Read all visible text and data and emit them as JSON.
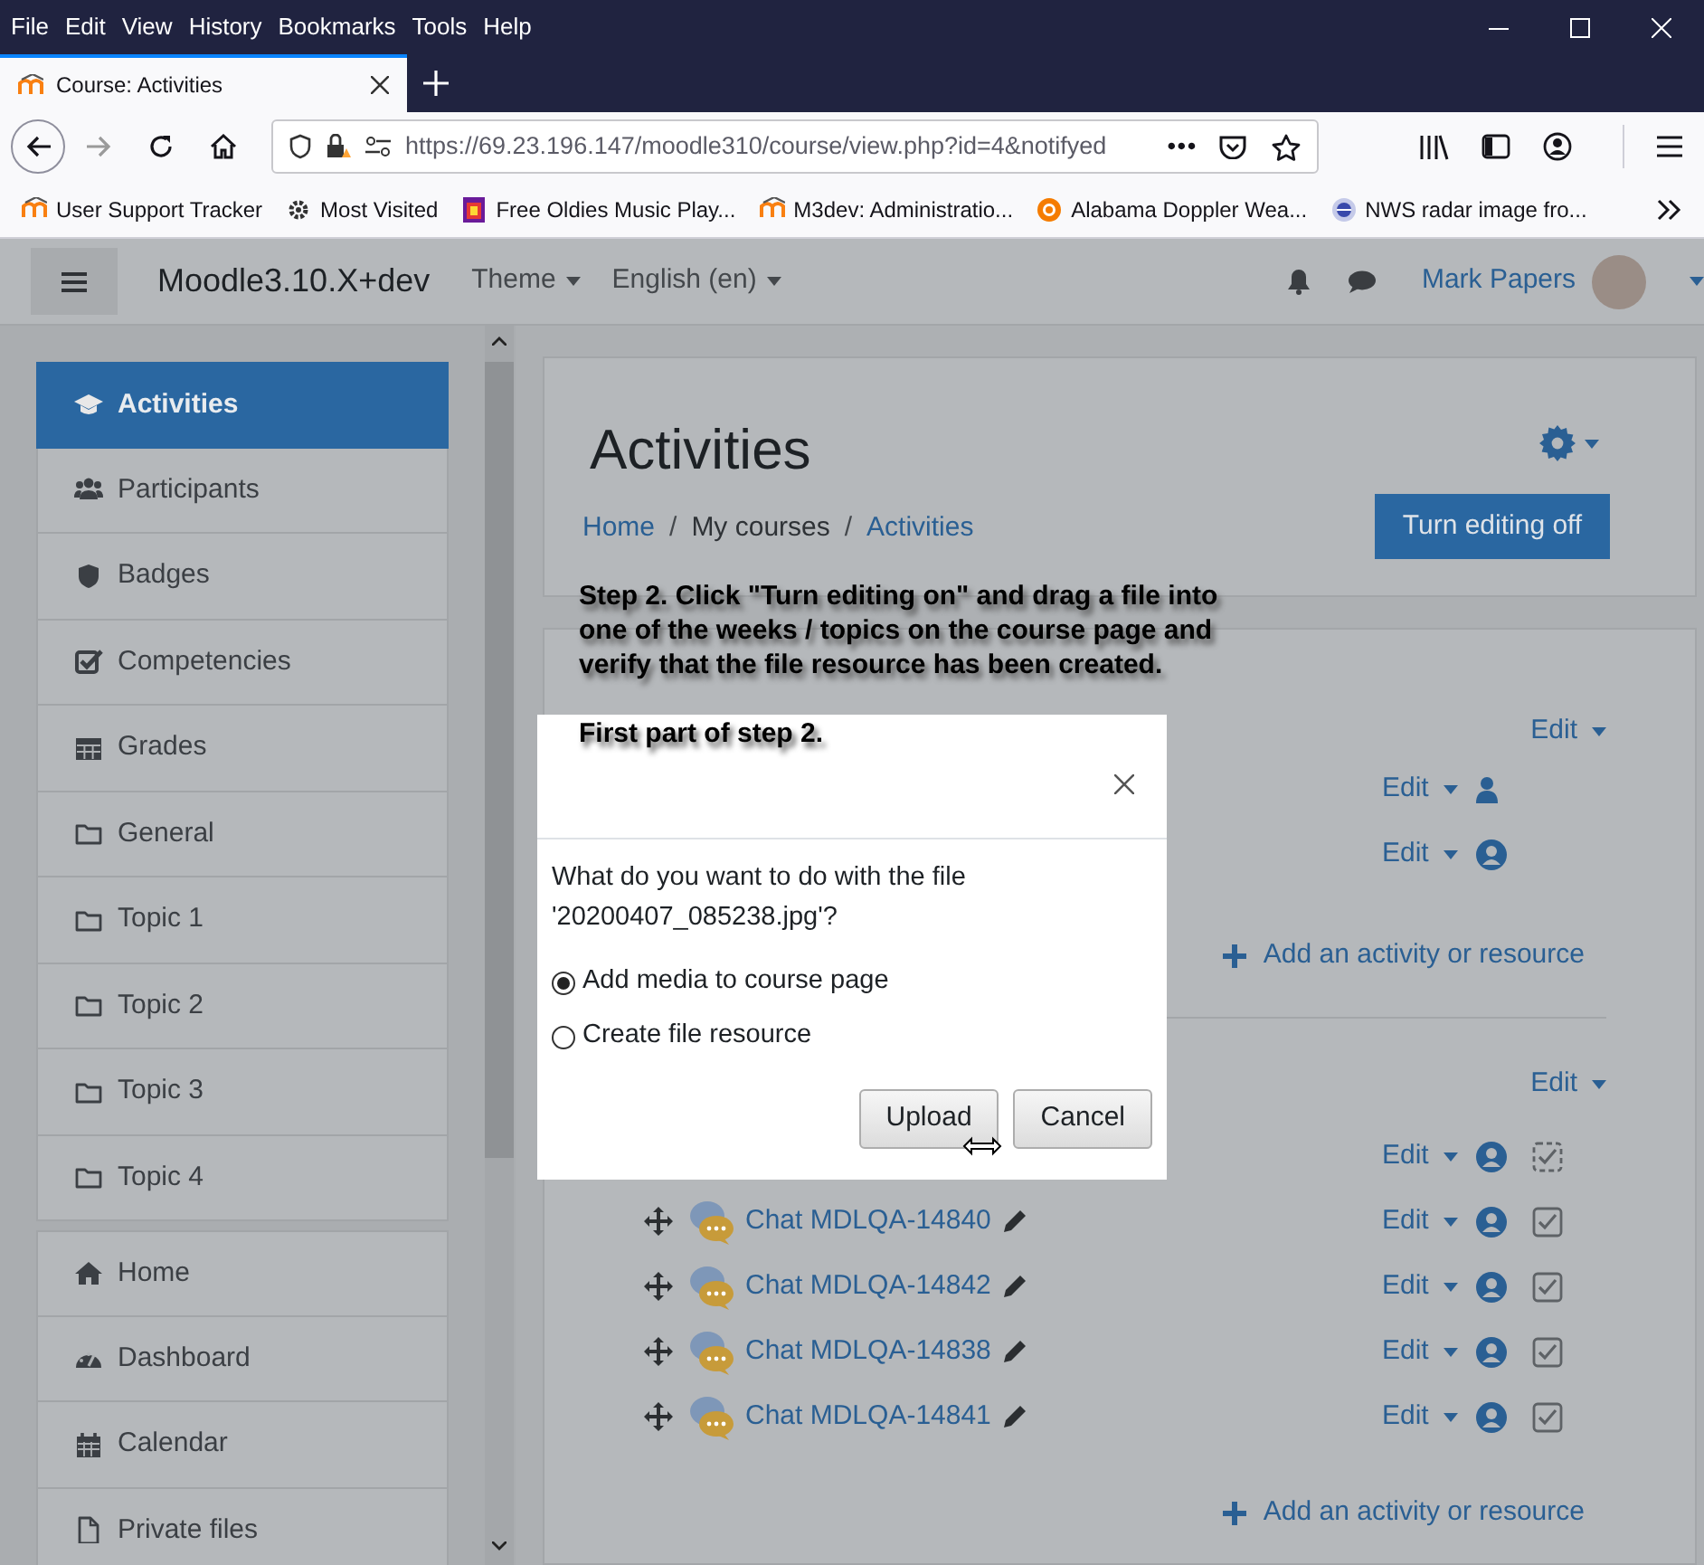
{
  "browser": {
    "menu": [
      "File",
      "Edit",
      "View",
      "History",
      "Bookmarks",
      "Tools",
      "Help"
    ],
    "tabs": [
      {
        "title": "Course: Activities",
        "selected": true
      }
    ],
    "url": "https://69.23.196.147/moodle310/course/view.php?id=4&notifyed",
    "page_actions": "•••",
    "bookmarks": [
      {
        "label": "User Support Tracker"
      },
      {
        "label": "Most Visited"
      },
      {
        "label": "Free Oldies Music Play..."
      },
      {
        "label": "M3dev: Administratio..."
      },
      {
        "label": "Alabama Doppler Wea..."
      },
      {
        "label": "NWS radar image fro..."
      }
    ]
  },
  "navbar": {
    "site_name": "Moodle3.10.X+dev",
    "menus": [
      "Theme",
      "English (en)"
    ],
    "user_name": "Mark Papers"
  },
  "sidebar": {
    "groups": [
      [
        {
          "label": "Activities",
          "selected": true
        },
        {
          "label": "Participants",
          "selected": false
        },
        {
          "label": "Badges",
          "selected": false
        },
        {
          "label": "Competencies",
          "selected": false
        },
        {
          "label": "Grades",
          "selected": false
        },
        {
          "label": "General",
          "selected": false
        },
        {
          "label": "Topic 1",
          "selected": false
        },
        {
          "label": "Topic 2",
          "selected": false
        },
        {
          "label": "Topic 3",
          "selected": false
        },
        {
          "label": "Topic 4",
          "selected": false
        }
      ],
      [
        {
          "label": "Home",
          "selected": false
        },
        {
          "label": "Dashboard",
          "selected": false
        },
        {
          "label": "Calendar",
          "selected": false
        },
        {
          "label": "Private files",
          "selected": false
        }
      ]
    ]
  },
  "header": {
    "title": "Activities",
    "breadcrumb": [
      {
        "label": "Home",
        "kind": "link"
      },
      {
        "label": "/",
        "kind": "separator"
      },
      {
        "label": "My courses",
        "kind": "text"
      },
      {
        "label": "/",
        "kind": "separator"
      },
      {
        "label": "Activities",
        "kind": "link"
      }
    ],
    "button": "Turn editing off"
  },
  "sections": [
    {
      "edit": "Edit",
      "activities": [
        {
          "edit": "Edit"
        },
        {
          "edit": "Edit"
        }
      ],
      "add_label": "Add an activity or resource"
    },
    {
      "edit": "Edit",
      "activities": [
        {
          "edit": "Edit",
          "completion": true,
          "automatic": true
        },
        {
          "name": "Chat MDLQA-14840",
          "edit": "Edit",
          "completion": true,
          "automatic": false
        },
        {
          "name": "Chat MDLQA-14842",
          "edit": "Edit",
          "completion": true,
          "automatic": false
        },
        {
          "name": "Chat MDLQA-14838",
          "edit": "Edit",
          "completion": true,
          "automatic": false
        },
        {
          "name": "Chat MDLQA-14841",
          "edit": "Edit",
          "completion": true,
          "automatic": false
        }
      ],
      "add_label": "Add an activity or resource"
    }
  ],
  "annotation": [
    "Step 2. Click \"Turn editing on\" and drag a file into one of the weeks / topics on the course page and verify that the file resource has been created.",
    "First part of step 2."
  ],
  "dialog": {
    "message": "What do you want to do with the file '20200407_085238.jpg'?",
    "options": [
      {
        "label": "Add media to course page",
        "selected": true
      },
      {
        "label": "Create file resource",
        "selected": false
      }
    ],
    "buttons": [
      "Upload",
      "Cancel"
    ]
  }
}
